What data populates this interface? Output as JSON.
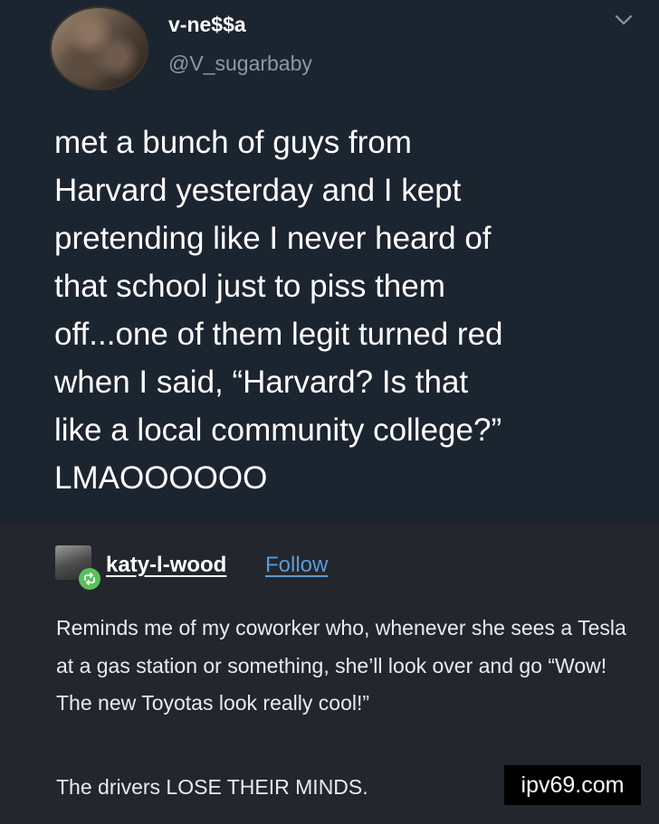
{
  "tweet": {
    "display_name": "v-ne$$a",
    "handle": "@V_sugarbaby",
    "text": "met a bunch of guys from\nHarvard yesterday and I kept\npretending like I never heard of\nthat school just to piss them\noff...one of them legit turned red\nwhen I said, “Harvard? Is that\nlike a local community college?”\nLMAOOOOOO"
  },
  "reply": {
    "username": "katy-l-wood",
    "follow_label": "Follow",
    "body": "Reminds me of my coworker who, whenever she sees a Tesla at a gas station or something, she’ll look over and go “Wow! The new Toyotas look really cool!”",
    "tail": "The drivers LOSE THEIR MINDS."
  },
  "watermark": "ipv69.com",
  "colors": {
    "tweet_bg": "#1b2530",
    "reply_bg": "#23272d",
    "link": "#5b9bd5",
    "reblog_green": "#58c05b"
  },
  "icons": {
    "tweet_menu": "chevron-down-icon",
    "reblog": "reblog-icon"
  }
}
